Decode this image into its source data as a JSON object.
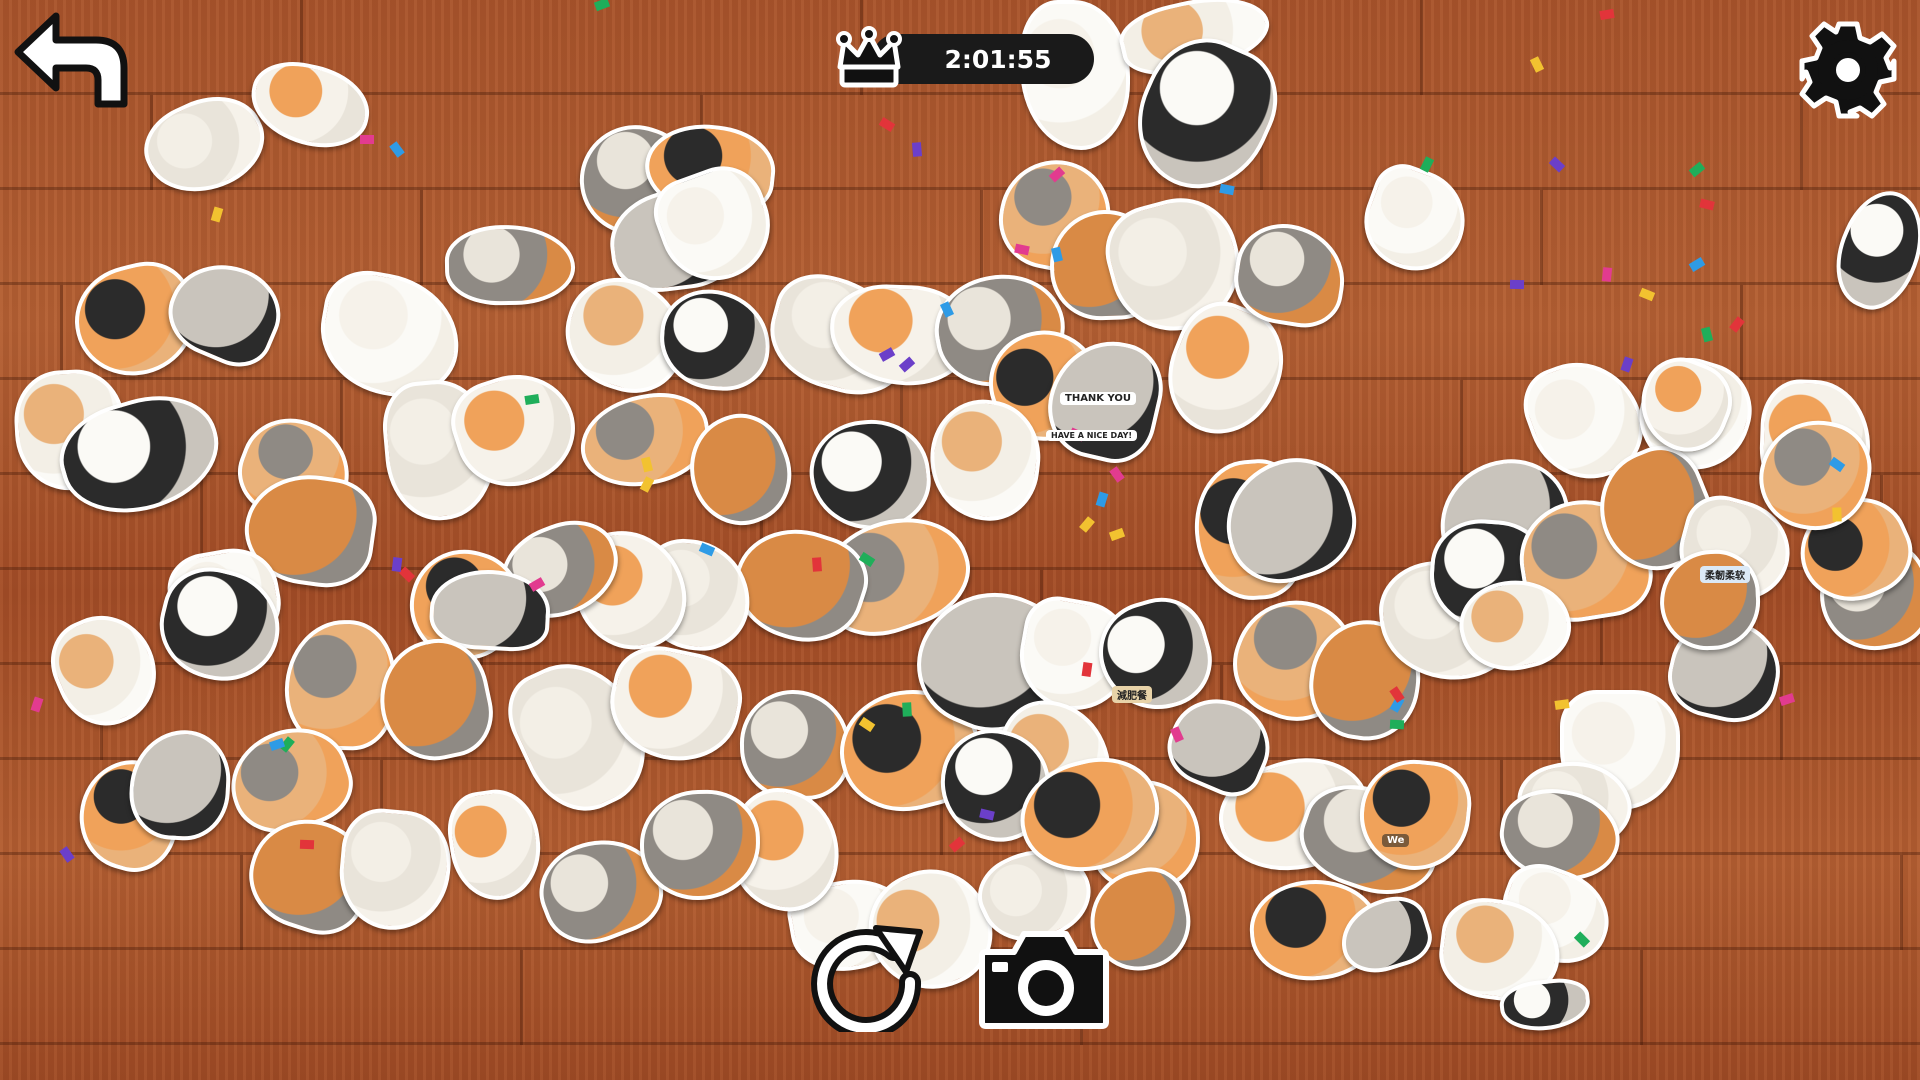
{
  "timer": {
    "elapsed": "2:01:55",
    "icon": "crown-icon"
  },
  "controls": {
    "back": "back-arrow-icon",
    "settings": "gear-icon",
    "restart": "restart-icon",
    "camera": "camera-icon"
  },
  "sticker_texts": {
    "thank_you": "THANK YOU",
    "nice_day": "HAVE A NICE DAY!",
    "box_label": "減肥餐",
    "tissue_label": "柔韌柔软",
    "cup_label": "We"
  },
  "colors": {
    "board": "#a8532b",
    "hud_dark": "#1a1a1a",
    "hud_white": "#ffffff"
  }
}
